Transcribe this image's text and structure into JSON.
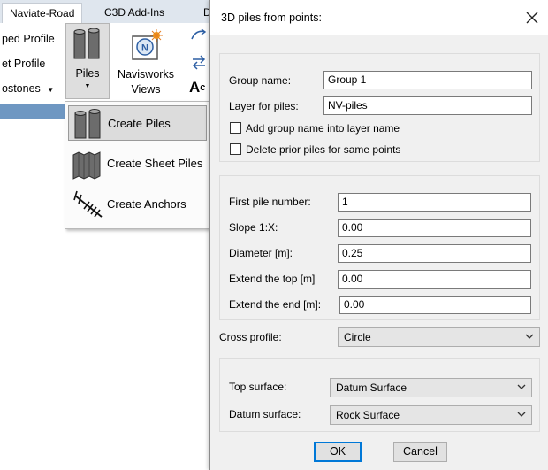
{
  "ribbon": {
    "tabs": [
      "Naviate-Road",
      "C3D Add-Ins",
      "D"
    ],
    "items": [
      "ped Profile",
      "et Profile",
      "ostones"
    ],
    "piles_label": "Piles",
    "navisworks_label_1": "Navisworks",
    "navisworks_label_2": "Views",
    "dropdown": [
      "Create Piles",
      "Create Sheet Piles",
      "Create Anchors"
    ]
  },
  "dialog": {
    "title": "3D piles from points:",
    "group_name_label": "Group name:",
    "group_name_value": "Group 1",
    "layer_label": "Layer for piles:",
    "layer_value": "NV-piles",
    "add_group_label": "Add group name into layer name",
    "delete_prior_label": "Delete prior piles for same points",
    "first_pile_label": "First pile number:",
    "first_pile_value": "1",
    "slope_label": "Slope 1:X:",
    "slope_value": "0.00",
    "diameter_label": "Diameter [m]:",
    "diameter_value": "0.25",
    "extend_top_label": "Extend the top [m]",
    "extend_top_value": "0.00",
    "extend_end_label": "Extend the end [m]:",
    "extend_end_value": "0.00",
    "cross_profile_label": "Cross profile:",
    "cross_profile_value": "Circle",
    "top_surface_label": "Top surface:",
    "top_surface_value": "Datum Surface",
    "datum_surface_label": "Datum surface:",
    "datum_surface_value": "Rock Surface",
    "ok_label": "OK",
    "cancel_label": "Cancel"
  }
}
